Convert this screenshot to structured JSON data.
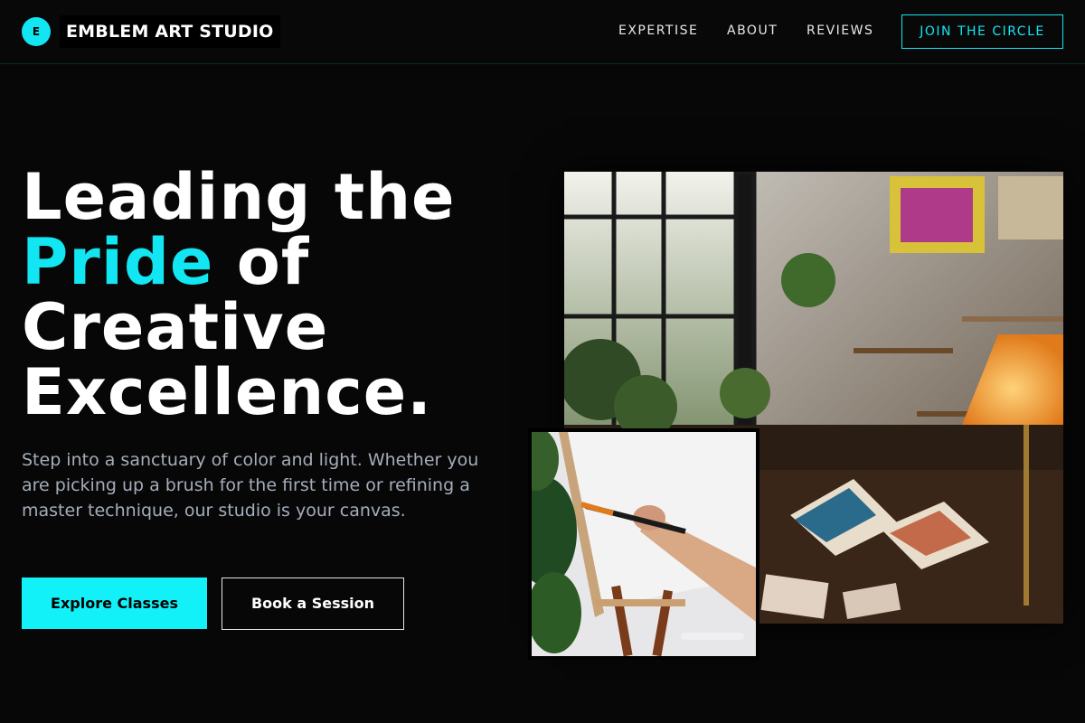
{
  "brand": {
    "initial": "E",
    "name": "EMBLEM ART STUDIO"
  },
  "nav": {
    "links": [
      "EXPERTISE",
      "ABOUT",
      "REVIEWS"
    ],
    "cta": "JOIN THE CIRCLE"
  },
  "hero": {
    "headline": {
      "line1": "Leading the",
      "accent": "Pride",
      "line2_rest": " of",
      "line3": "Creative",
      "line4": "Excellence."
    },
    "subtitle": "Step into a sanctuary of color and light. Whether you are picking up a brush for the first time or refining a master technique, our studio is your canvas.",
    "primary_button": "Explore Classes",
    "secondary_button": "Book a Session"
  },
  "colors": {
    "accent": "#12e6f2",
    "background": "#070707",
    "subtitle": "#a5adbb"
  }
}
